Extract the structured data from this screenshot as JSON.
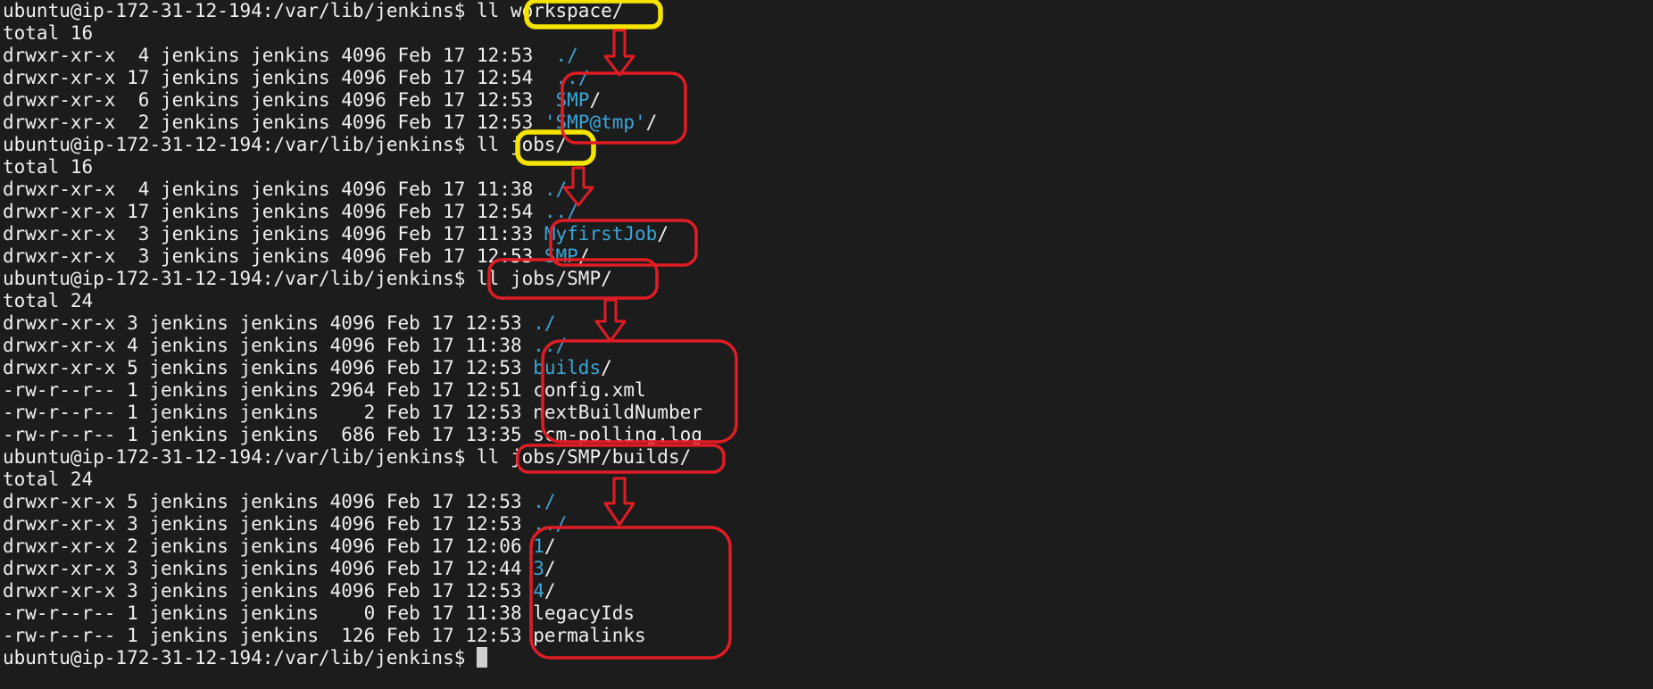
{
  "terminal": {
    "lines": [
      {
        "prompt": "ubuntu@ip-172-31-12-194:/var/lib/jenkins$ ",
        "command": "ll workspace/"
      },
      {
        "text": "total 16"
      },
      {
        "meta": "drwxr-xr-x  4 jenkins jenkins 4096 Feb 17 12:53  ",
        "name": "./",
        "is_dir": true
      },
      {
        "meta": "drwxr-xr-x 17 jenkins jenkins 4096 Feb 17 12:54  ",
        "name": "../",
        "is_dir": true
      },
      {
        "meta": "drwxr-xr-x  6 jenkins jenkins 4096 Feb 17 12:53  ",
        "name": "SMP",
        "is_dir": true,
        "suffix": "/"
      },
      {
        "meta": "drwxr-xr-x  2 jenkins jenkins 4096 Feb 17 12:53 ",
        "name": "'SMP@tmp'",
        "is_dir": true,
        "suffix": "/"
      },
      {
        "prompt": "ubuntu@ip-172-31-12-194:/var/lib/jenkins$ ",
        "command": "ll jobs/"
      },
      {
        "text": "total 16"
      },
      {
        "meta": "drwxr-xr-x  4 jenkins jenkins 4096 Feb 17 11:38 ",
        "name": "./",
        "is_dir": true
      },
      {
        "meta": "drwxr-xr-x 17 jenkins jenkins 4096 Feb 17 12:54 ",
        "name": "../",
        "is_dir": true
      },
      {
        "meta": "drwxr-xr-x  3 jenkins jenkins 4096 Feb 17 11:33 ",
        "name": "MyfirstJob",
        "is_dir": true,
        "suffix": "/"
      },
      {
        "meta": "drwxr-xr-x  3 jenkins jenkins 4096 Feb 17 12:53 ",
        "name": "SMP",
        "is_dir": true,
        "suffix": "/"
      },
      {
        "prompt": "ubuntu@ip-172-31-12-194:/var/lib/jenkins$ ",
        "command": "ll jobs/SMP/"
      },
      {
        "text": "total 24"
      },
      {
        "meta": "drwxr-xr-x 3 jenkins jenkins 4096 Feb 17 12:53 ",
        "name": "./",
        "is_dir": true
      },
      {
        "meta": "drwxr-xr-x 4 jenkins jenkins 4096 Feb 17 11:38 ",
        "name": "../",
        "is_dir": true
      },
      {
        "meta": "drwxr-xr-x 5 jenkins jenkins 4096 Feb 17 12:53 ",
        "name": "builds",
        "is_dir": true,
        "suffix": "/"
      },
      {
        "meta": "-rw-r--r-- 1 jenkins jenkins 2964 Feb 17 12:51 ",
        "name": "config.xml",
        "is_dir": false
      },
      {
        "meta": "-rw-r--r-- 1 jenkins jenkins    2 Feb 17 12:53 ",
        "name": "nextBuildNumber",
        "is_dir": false
      },
      {
        "meta": "-rw-r--r-- 1 jenkins jenkins  686 Feb 17 13:35 ",
        "name": "scm-polling.log",
        "is_dir": false
      },
      {
        "prompt": "ubuntu@ip-172-31-12-194:/var/lib/jenkins$ ",
        "command": "ll jobs/SMP/builds/"
      },
      {
        "text": "total 24"
      },
      {
        "meta": "drwxr-xr-x 5 jenkins jenkins 4096 Feb 17 12:53 ",
        "name": "./",
        "is_dir": true
      },
      {
        "meta": "drwxr-xr-x 3 jenkins jenkins 4096 Feb 17 12:53 ",
        "name": "../",
        "is_dir": true
      },
      {
        "meta": "drwxr-xr-x 2 jenkins jenkins 4096 Feb 17 12:06 ",
        "name": "1",
        "is_dir": true,
        "suffix": "/"
      },
      {
        "meta": "drwxr-xr-x 3 jenkins jenkins 4096 Feb 17 12:44 ",
        "name": "3",
        "is_dir": true,
        "suffix": "/"
      },
      {
        "meta": "drwxr-xr-x 3 jenkins jenkins 4096 Feb 17 12:53 ",
        "name": "4",
        "is_dir": true,
        "suffix": "/"
      },
      {
        "meta": "-rw-r--r-- 1 jenkins jenkins    0 Feb 17 11:38 ",
        "name": "legacyIds",
        "is_dir": false
      },
      {
        "meta": "-rw-r--r-- 1 jenkins jenkins  126 Feb 17 12:53 ",
        "name": "permalinks",
        "is_dir": false
      },
      {
        "prompt": "ubuntu@ip-172-31-12-194:/var/lib/jenkins$ ",
        "command": "",
        "cursor": true
      }
    ]
  },
  "colors": {
    "background": "#1c1c1c",
    "text": "#f0f0f0",
    "directory": "#3aa6d8",
    "annotation_red": "#e01c24",
    "annotation_yellow": "#f4e400"
  }
}
